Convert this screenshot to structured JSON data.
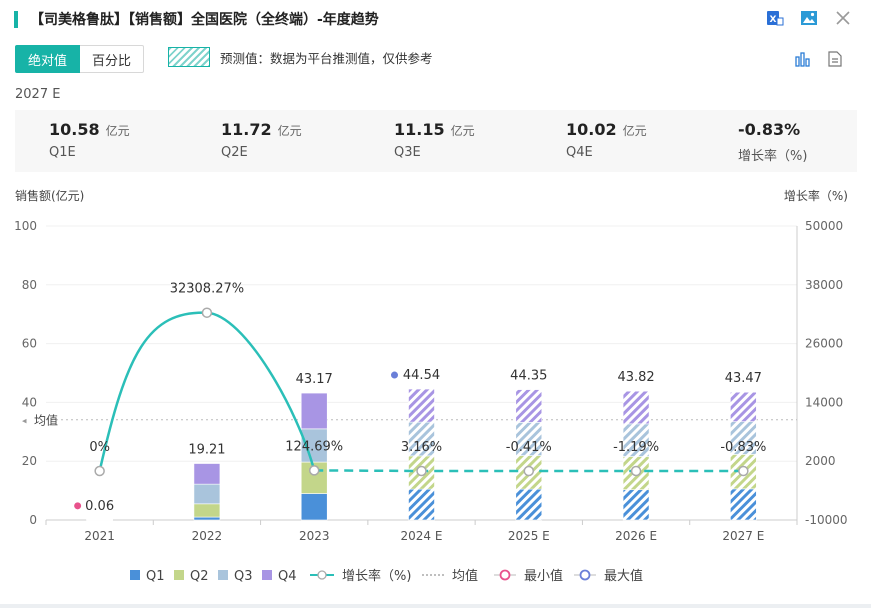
{
  "title": "【司美格鲁肽】【销售额】全国医院（全终端）-年度趋势",
  "toggle": {
    "absolute": "绝对值",
    "percent": "百分比"
  },
  "forecast_note": "预测值：数据为平台推测值，仅供参考",
  "year_label": "2027 E",
  "stats": [
    {
      "value": "10.58",
      "unit": "亿元",
      "label": "Q1E"
    },
    {
      "value": "11.72",
      "unit": "亿元",
      "label": "Q2E"
    },
    {
      "value": "11.15",
      "unit": "亿元",
      "label": "Q3E"
    },
    {
      "value": "10.02",
      "unit": "亿元",
      "label": "Q4E"
    },
    {
      "value": "-0.83%",
      "unit": "",
      "label": "增长率（%)"
    }
  ],
  "chart_data": {
    "type": "bar",
    "stacked": true,
    "categories": [
      "2021",
      "2022",
      "2023",
      "2024 E",
      "2025 E",
      "2026 E",
      "2027 E"
    ],
    "forecast": [
      false,
      false,
      false,
      true,
      true,
      true,
      true
    ],
    "series": [
      {
        "name": "Q1",
        "color": "#4a90d9",
        "values": [
          0.01,
          1.0,
          9.0,
          10.5,
          10.5,
          10.3,
          10.58
        ]
      },
      {
        "name": "Q2",
        "color": "#c3d68a",
        "values": [
          0.01,
          4.5,
          10.7,
          11.3,
          11.4,
          11.3,
          11.72
        ]
      },
      {
        "name": "Q3",
        "color": "#a9c4dc",
        "values": [
          0.02,
          6.7,
          11.3,
          11.5,
          11.3,
          11.1,
          11.15
        ]
      },
      {
        "name": "Q4",
        "color": "#a895e4",
        "values": [
          0.02,
          7.01,
          12.17,
          11.24,
          11.15,
          11.12,
          10.02
        ]
      }
    ],
    "totals": [
      0.06,
      19.21,
      43.17,
      44.54,
      44.35,
      43.82,
      43.47
    ],
    "total_labels": [
      "0.06",
      "19.21",
      "43.17",
      "44.54",
      "44.35",
      "43.82",
      "43.47"
    ],
    "growth": {
      "name": "增长率（%)",
      "color": "#2bbfb8",
      "values": [
        0,
        32308.27,
        124.69,
        3.16,
        -0.41,
        -1.19,
        -0.83
      ],
      "labels": [
        "0%",
        "32308.27%",
        "124.69%",
        "3.16%",
        "-0.41%",
        "-1.19%",
        "-0.83%"
      ]
    },
    "min_index": 0,
    "max_index": 3,
    "avg_label": "均值",
    "avg_value": 34.1,
    "ylabel_left": "销售额(亿元)",
    "ylabel_right": "增长率（%)",
    "ylim": [
      0,
      100
    ],
    "yticks_left": [
      "0",
      "20",
      "40",
      "60",
      "80",
      "100"
    ],
    "ylim_right": [
      -10000,
      50000
    ],
    "yticks_right": [
      "-10000",
      "2000",
      "14000",
      "26000",
      "38000",
      "50000"
    ],
    "legend": [
      {
        "name": "Q1",
        "kind": "square",
        "color": "#4a90d9"
      },
      {
        "name": "Q2",
        "kind": "square",
        "color": "#c3d68a"
      },
      {
        "name": "Q3",
        "kind": "square",
        "color": "#a9c4dc"
      },
      {
        "name": "Q4",
        "kind": "square",
        "color": "#a895e4"
      },
      {
        "name": "增长率（%)",
        "kind": "line-circle",
        "color": "#2bbfb8"
      },
      {
        "name": "均值",
        "kind": "dotted",
        "color": "#aaaaaa"
      },
      {
        "name": "最小值",
        "kind": "circle",
        "color": "#e8528c"
      },
      {
        "name": "最大值",
        "kind": "circle",
        "color": "#6a7fd8"
      }
    ]
  }
}
